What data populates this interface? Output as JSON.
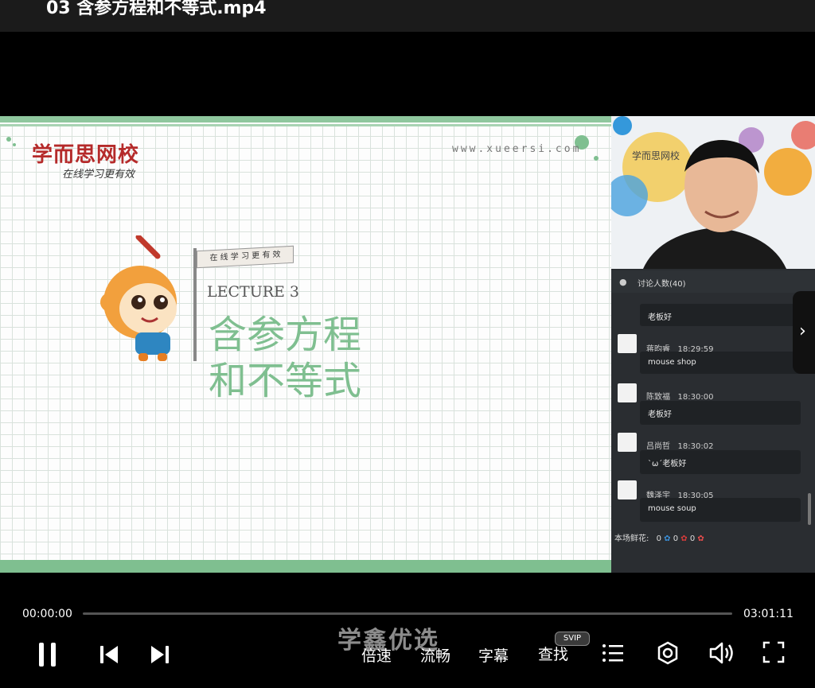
{
  "window": {
    "title": "03 含参方程和不等式.mp4"
  },
  "slide": {
    "brand": "学而思网校",
    "slogan": "在线学习更有效",
    "url": "www.xueersi.com",
    "flag_text": "在 线 学 习 更 有 效",
    "lecture": "LECTURE 3",
    "heading_line1": "含参方程",
    "heading_line2": "和不等式"
  },
  "camera": {
    "brand": "学而思网校"
  },
  "chat": {
    "header": "讨论人数(40)",
    "messages": [
      {
        "name": "",
        "time": "",
        "text": "老板好"
      },
      {
        "name": "蒋昀睿",
        "time": "18:29:59",
        "text": "mouse shop"
      },
      {
        "name": "陈致福",
        "time": "18:30:00",
        "text": "老板好"
      },
      {
        "name": "吕尚哲",
        "time": "18:30:02",
        "text": "`ω´老板好"
      },
      {
        "name": "魏泽宇",
        "time": "18:30:05",
        "text": "mouse soup"
      }
    ],
    "flowers_label": "本场鲜花:",
    "flower_counts": [
      "0",
      "0",
      "0"
    ]
  },
  "player": {
    "current_time": "00:00:00",
    "total_time": "03:01:11",
    "progress": 0,
    "speed_label": "倍速",
    "quality_label": "流畅",
    "subtitle_label": "字幕",
    "search_label": "查找",
    "svip_badge": "SVIP",
    "watermark": "学鑫优选"
  }
}
